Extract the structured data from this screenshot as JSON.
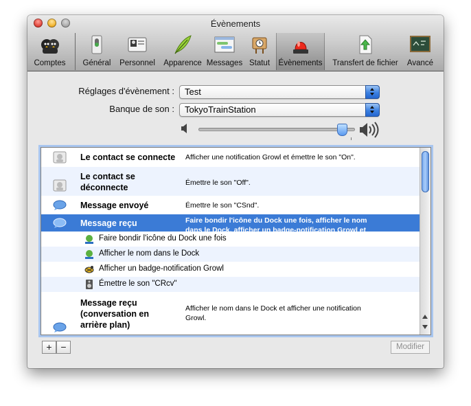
{
  "window": {
    "title": "Évènements"
  },
  "toolbar": {
    "items": [
      {
        "label": "Comptes",
        "icon": "accounts-icon"
      },
      {
        "label": "Général",
        "icon": "general-switch-icon"
      },
      {
        "label": "Personnel",
        "icon": "personal-card-icon"
      },
      {
        "label": "Apparence",
        "icon": "appearance-feather-icon"
      },
      {
        "label": "Messages",
        "icon": "messages-window-icon"
      },
      {
        "label": "Statut",
        "icon": "status-sign-icon"
      },
      {
        "label": "Évènements",
        "icon": "events-siren-icon",
        "selected": true
      },
      {
        "label": "Transfert de fichier",
        "icon": "file-transfer-icon"
      },
      {
        "label": "Avancé",
        "icon": "advanced-chalkboard-icon"
      }
    ]
  },
  "settings": {
    "event_set_label": "Réglages d'évènement :",
    "event_set_value": "Test",
    "sound_bank_label": "Banque de son :",
    "sound_bank_value": "TokyoTrainStation",
    "volume_level": 0.95
  },
  "events": [
    {
      "name": "Le contact se connecte",
      "description": "Afficher une notification Growl et émettre le son \"On\"."
    },
    {
      "name": "Le contact se déconnecte",
      "name_lines": [
        "Le contact se",
        "déconnecte"
      ],
      "description": "Émettre le son \"Off\"."
    },
    {
      "name": "Message envoyé",
      "description": "Émettre le son \"CSnd\"."
    },
    {
      "name": "Message reçu",
      "description_lines": [
        "Faire bondir l'icône du Dock une fois, afficher le nom",
        "dans le Dock, afficher un badge-notification Growl et"
      ],
      "selected": true,
      "actions": [
        {
          "label": "Faire bondir l'icône du Dock une fois",
          "icon": "dock-bounce-icon"
        },
        {
          "label": "Afficher le nom dans le Dock",
          "icon": "dock-name-icon"
        },
        {
          "label": "Afficher un badge-notification Growl",
          "icon": "growl-icon"
        },
        {
          "label": "Émettre le son \"CRcv\"",
          "icon": "speaker-icon"
        }
      ]
    },
    {
      "name_lines": [
        "Message reçu",
        "(conversation en",
        "arrière plan)"
      ],
      "description_lines": [
        "Afficher le nom dans le Dock et afficher une notification",
        "Growl."
      ]
    }
  ],
  "buttons": {
    "add": "+",
    "remove": "−",
    "modify": "Modifier"
  },
  "colors": {
    "selection": "#3b7bd6",
    "alt_row": "#edf3fe",
    "focus_ring": "#a9c6ef"
  }
}
